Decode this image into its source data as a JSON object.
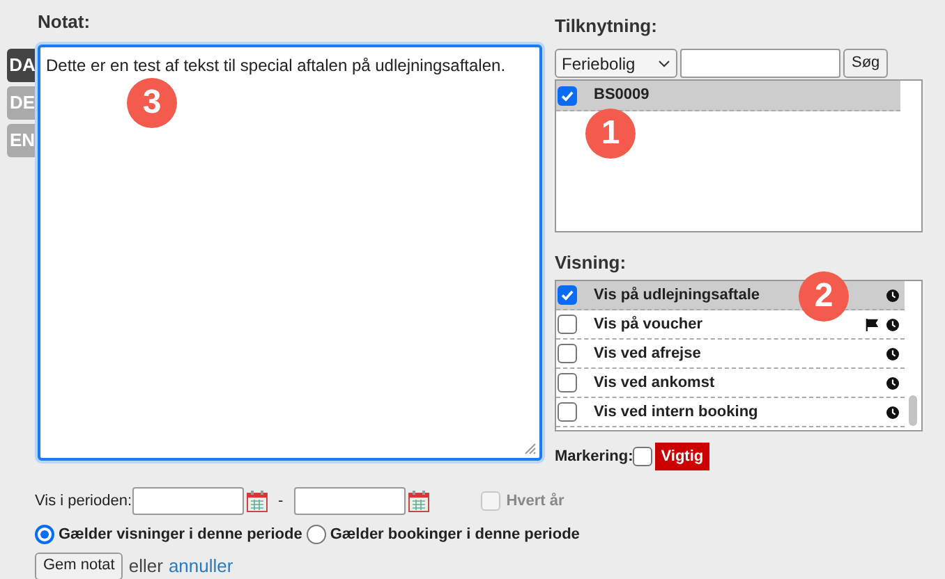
{
  "note": {
    "title": "Notat:",
    "text": "Dette er en test af tekst til special aftalen på udlejningsaftalen.",
    "languages": [
      {
        "label": "DA",
        "selected": true
      },
      {
        "label": "DE",
        "selected": false
      },
      {
        "label": "EN",
        "selected": false
      }
    ]
  },
  "attachment": {
    "title": "Tilknytning:",
    "type_select": "Feriebolig",
    "search_button": "Søg",
    "items": [
      {
        "label": "BS0009",
        "checked": true,
        "selected": true
      }
    ]
  },
  "display": {
    "title": "Visning:",
    "items": [
      {
        "label": "Vis på udlejningsaftale",
        "checked": true,
        "selected": true,
        "flagged": false
      },
      {
        "label": "Vis på voucher",
        "checked": false,
        "selected": false,
        "flagged": true
      },
      {
        "label": "Vis ved afrejse",
        "checked": false,
        "selected": false,
        "flagged": false
      },
      {
        "label": "Vis ved ankomst",
        "checked": false,
        "selected": false,
        "flagged": false
      },
      {
        "label": "Vis ved intern booking",
        "checked": false,
        "selected": false,
        "flagged": false
      }
    ]
  },
  "marking": {
    "label": "Markering:",
    "checked": false,
    "tag": "Vigtig",
    "color": "#cc0000"
  },
  "period": {
    "label": "Vis i perioden:",
    "separator": "-",
    "every_year": {
      "label": "Hvert år",
      "checked": false,
      "disabled": true
    },
    "options": [
      {
        "label": "Gælder visninger i denne periode",
        "selected": true
      },
      {
        "label": "Gælder bookinger i denne periode",
        "selected": false
      }
    ]
  },
  "actions": {
    "save": "Gem notat",
    "or": "eller",
    "cancel": "annuller"
  },
  "callouts": [
    "1",
    "2",
    "3"
  ]
}
